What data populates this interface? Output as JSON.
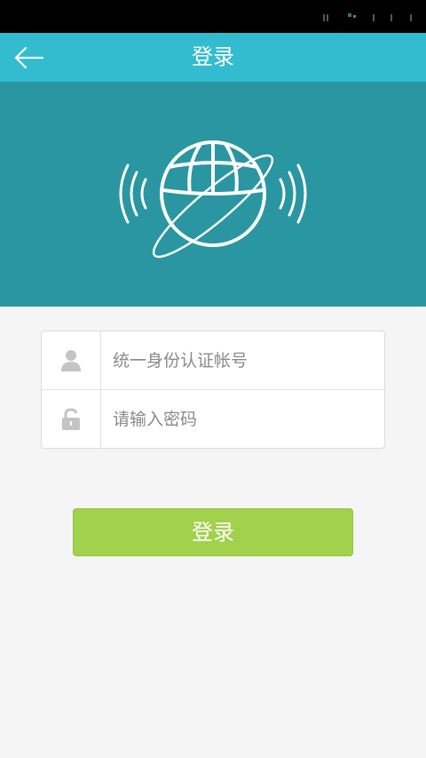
{
  "header": {
    "title": "登录"
  },
  "login_form": {
    "account_placeholder": "统一身份认证帐号",
    "account_value": "",
    "password_placeholder": "请输入密码",
    "password_value": ""
  },
  "actions": {
    "login_label": "登录"
  },
  "icons": {
    "back": "arrow-left-icon",
    "hero": "globe-orbit-signal-icon",
    "user": "user-icon",
    "lock": "unlocked-padlock-icon"
  },
  "colors": {
    "app_bar": "#33bccf",
    "hero_bg": "#2996a2",
    "login_button": "#a2d14b",
    "page_bg": "#f5f5f5"
  }
}
